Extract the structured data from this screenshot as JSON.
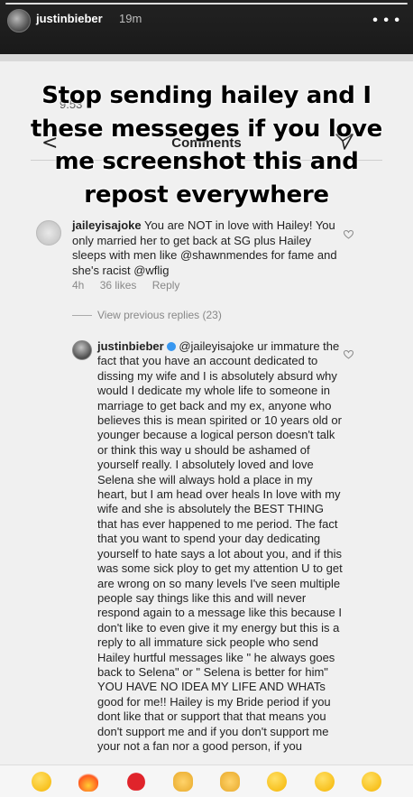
{
  "story": {
    "username": "justinbieber",
    "time": "19m"
  },
  "overlay_text": "Stop sending hailey and I these messeges if you love me screenshot this and repost everywhere",
  "screenshot": {
    "status_time": "9:53",
    "page_title": "Comments",
    "comments": [
      {
        "username": "jaileyisajoke",
        "text": "You are NOT in love with Hailey! You only married her to get back at SG plus Hailey sleeps with men like @shawnmendes for fame and she's racist @wflig",
        "age": "4h",
        "likes": "36 likes",
        "reply_label": "Reply"
      }
    ],
    "view_previous": "View previous replies (23)",
    "reply": {
      "username": "justinbieber",
      "text": "@jaileyisajoke ur immature the fact that you have an account dedicated to dissing my wife and I is absolutely absurd why would I dedicate my whole life to someone in marriage to get back and my ex, anyone who believes this is mean spirited or 10 years old or younger because a logical person doesn't talk or think this way u should be ashamed of yourself really.  I absolutely loved and love Selena she will always hold a place in my heart, but I am head over heals In love with my wife and she is absolutely the BEST THING that has ever happened to me period. The fact that you want to spend your day dedicating yourself to hate says a lot about you, and if this was some sick ploy to get my attention U to get are wrong on so many levels I've seen multiple people say things like this and will never respond again to a message like this because I don't like to even give it my energy but this is a reply to all immature sick people who send Hailey hurtful messages like \" he always goes back to Selena\" or \" Selena is better for him\" YOU HAVE NO IDEA MY LIFE AND WHATs good for me!! Hailey is my Bride period if you dont like that or support that that means you don't support me and if you don't support me your not a fan nor a good person, if you"
    },
    "emoji_bar": [
      "face-emoji",
      "fire-emoji",
      "heart-emoji",
      "raised-hands-emoji",
      "clap-emoji",
      "crying-face-emoji",
      "heart-eyes-emoji",
      "tears-of-joy-emoji"
    ]
  }
}
